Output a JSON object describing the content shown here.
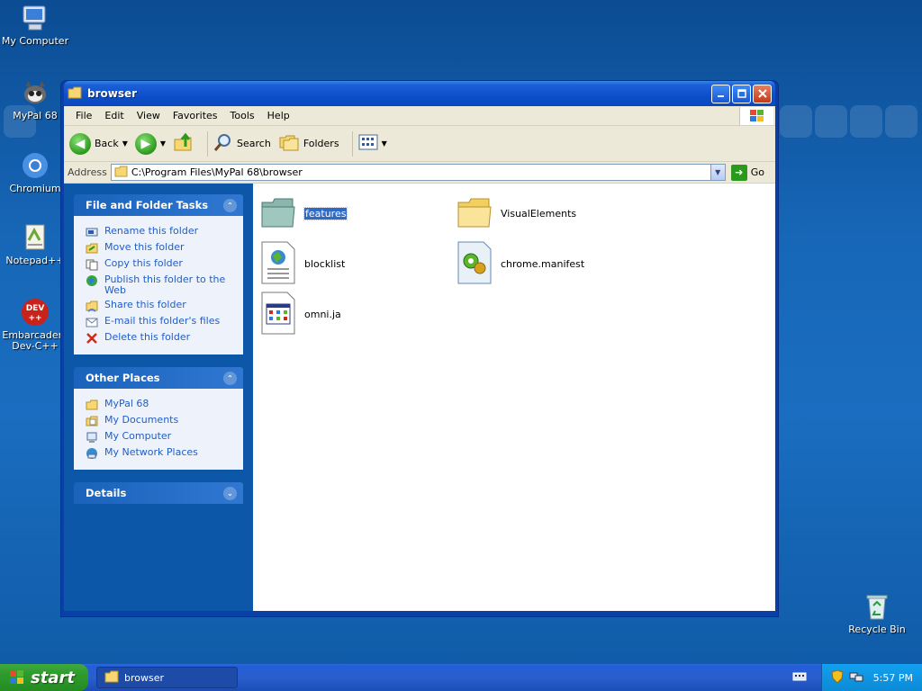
{
  "desktop": {
    "icons": [
      {
        "label": "My Computer"
      },
      {
        "label": "MyPal 68"
      },
      {
        "label": "Chromium"
      },
      {
        "label": "Notepad++"
      },
      {
        "label": "Embarcadero Dev-C++"
      },
      {
        "label": "Recycle Bin"
      }
    ]
  },
  "window": {
    "title": "browser",
    "menu": [
      "File",
      "Edit",
      "View",
      "Favorites",
      "Tools",
      "Help"
    ],
    "toolbar": {
      "back": "Back",
      "search": "Search",
      "folders": "Folders"
    },
    "address": {
      "label": "Address",
      "value": "C:\\Program Files\\MyPal 68\\browser",
      "go": "Go"
    },
    "tasks_panel": {
      "title": "File and Folder Tasks",
      "items": [
        "Rename this folder",
        "Move this folder",
        "Copy this folder",
        "Publish this folder to the Web",
        "Share this folder",
        "E-mail this folder's files",
        "Delete this folder"
      ]
    },
    "places_panel": {
      "title": "Other Places",
      "items": [
        "MyPal 68",
        "My Documents",
        "My Computer",
        "My Network Places"
      ]
    },
    "details_panel": {
      "title": "Details"
    },
    "files": [
      {
        "name": "features",
        "kind": "folder-teal",
        "selected": true
      },
      {
        "name": "VisualElements",
        "kind": "folder"
      },
      {
        "name": "blocklist",
        "kind": "xml-icon"
      },
      {
        "name": "chrome.manifest",
        "kind": "gear-file-icon"
      },
      {
        "name": "omni.ja",
        "kind": "app-file-icon"
      }
    ]
  },
  "taskbar": {
    "start": "start",
    "task": "browser",
    "clock": "5:57 PM"
  },
  "colors": {
    "accent": "#0a48bd",
    "link": "#215dc6",
    "selection": "#316ac5",
    "start": "#2e9a2c"
  }
}
